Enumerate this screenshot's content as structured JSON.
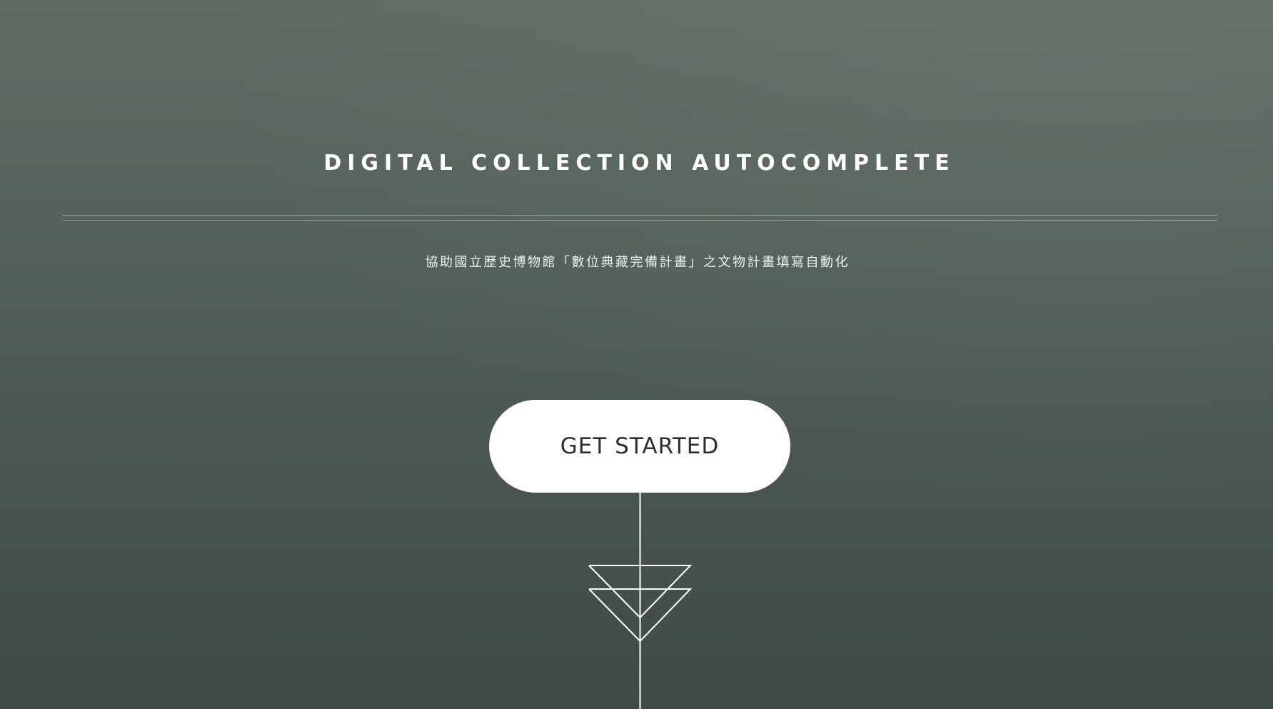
{
  "hero": {
    "title": "DIGITAL COLLECTION AUTOCOMPLETE",
    "subtitle": "協助國立歷史博物館「數位典藏完備計畫」之文物計畫填寫自動化",
    "cta_label": "GET STARTED"
  },
  "colors": {
    "background_top": "#5f6b63",
    "background_bottom": "#3f4a47",
    "text": "#ffffff",
    "button_bg": "#ffffff",
    "button_text": "#2b302e"
  },
  "icons": {
    "scroll_down": "double-chevron-down-icon"
  }
}
